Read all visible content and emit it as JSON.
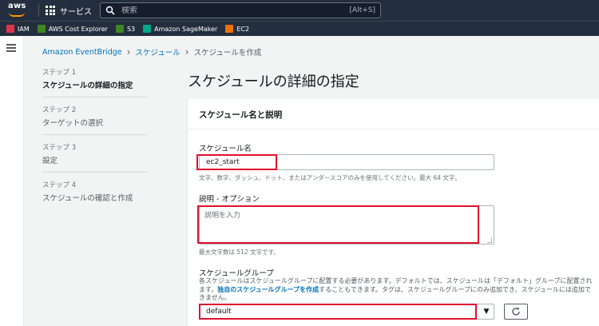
{
  "header": {
    "logo_text": "aws",
    "services_label": "サービス",
    "search_placeholder": "検索",
    "search_shortcut": "[Alt+S]"
  },
  "favorites": [
    {
      "label": "IAM",
      "color": "#dd344c"
    },
    {
      "label": "AWS Cost Explorer",
      "color": "#3f8624"
    },
    {
      "label": "S3",
      "color": "#3f8624"
    },
    {
      "label": "Amazon SageMaker",
      "color": "#01a88d"
    },
    {
      "label": "EC2",
      "color": "#ed7100"
    }
  ],
  "breadcrumb": {
    "items": [
      "Amazon EventBridge",
      "スケジュール"
    ],
    "current": "スケジュールを作成"
  },
  "steps": [
    {
      "num": "ステップ 1",
      "label": "スケジュールの詳細の指定",
      "active": true
    },
    {
      "num": "ステップ 2",
      "label": "ターゲットの選択",
      "active": false
    },
    {
      "num": "ステップ 3",
      "label": "設定",
      "active": false
    },
    {
      "num": "ステップ 4",
      "label": "スケジュールの確認と作成",
      "active": false
    }
  ],
  "page": {
    "title": "スケジュールの詳細の指定"
  },
  "panel": {
    "header": "スケジュール名と説明",
    "name": {
      "label": "スケジュール名",
      "value": "ec2_start",
      "hint": "文字、数字、ダッシュ、ドット、またはアンダースコアのみを使用してください。最大 64 文字。"
    },
    "description": {
      "label": "説明 - オプション",
      "placeholder": "説明を入力",
      "hint": "最大文字数は 512 文字です。"
    },
    "group": {
      "label": "スケジュールグループ",
      "desc_before": "各スケジュールはスケジュールグループに配置する必要があります。デフォルトでは、スケジュールは「デフォルト」グループに配置されます。",
      "desc_link": "独自のスケジュールグループを作成",
      "desc_after": "することもできます。タグは、スケジュールグループにのみ追加でき、スケジュールには追加できません。",
      "selected": "default"
    }
  },
  "colors": {
    "nav_bg": "#232f3e",
    "link": "#0073bb",
    "annotation": "#e1102e"
  }
}
